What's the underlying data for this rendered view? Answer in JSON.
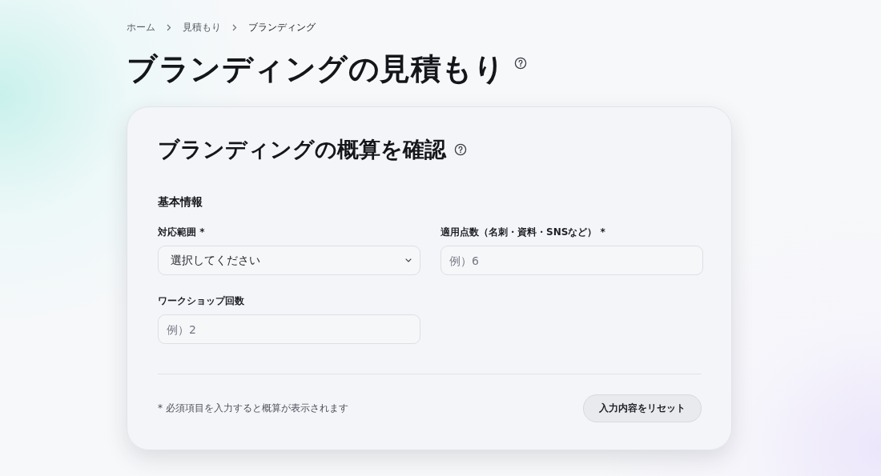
{
  "breadcrumb": [
    {
      "label": "ホーム",
      "current": false
    },
    {
      "label": "見積もり",
      "current": false
    },
    {
      "label": "ブランディング",
      "current": true
    }
  ],
  "page_title": "ブランディングの見積もり",
  "card": {
    "title": "ブランディングの概算を確認",
    "section": "基本情報",
    "fields": [
      {
        "kind": "select",
        "label": "対応範囲 *",
        "value": "選択してください"
      },
      {
        "kind": "input",
        "label": "適用点数（名刺・資料・SNSなど） *",
        "placeholder": "例）6"
      },
      {
        "kind": "input",
        "label": "ワークショップ回数",
        "placeholder": "例）2"
      }
    ],
    "note": "* 必須項目を入力すると概算が表示されます",
    "reset_button": "入力内容をリセット"
  }
}
